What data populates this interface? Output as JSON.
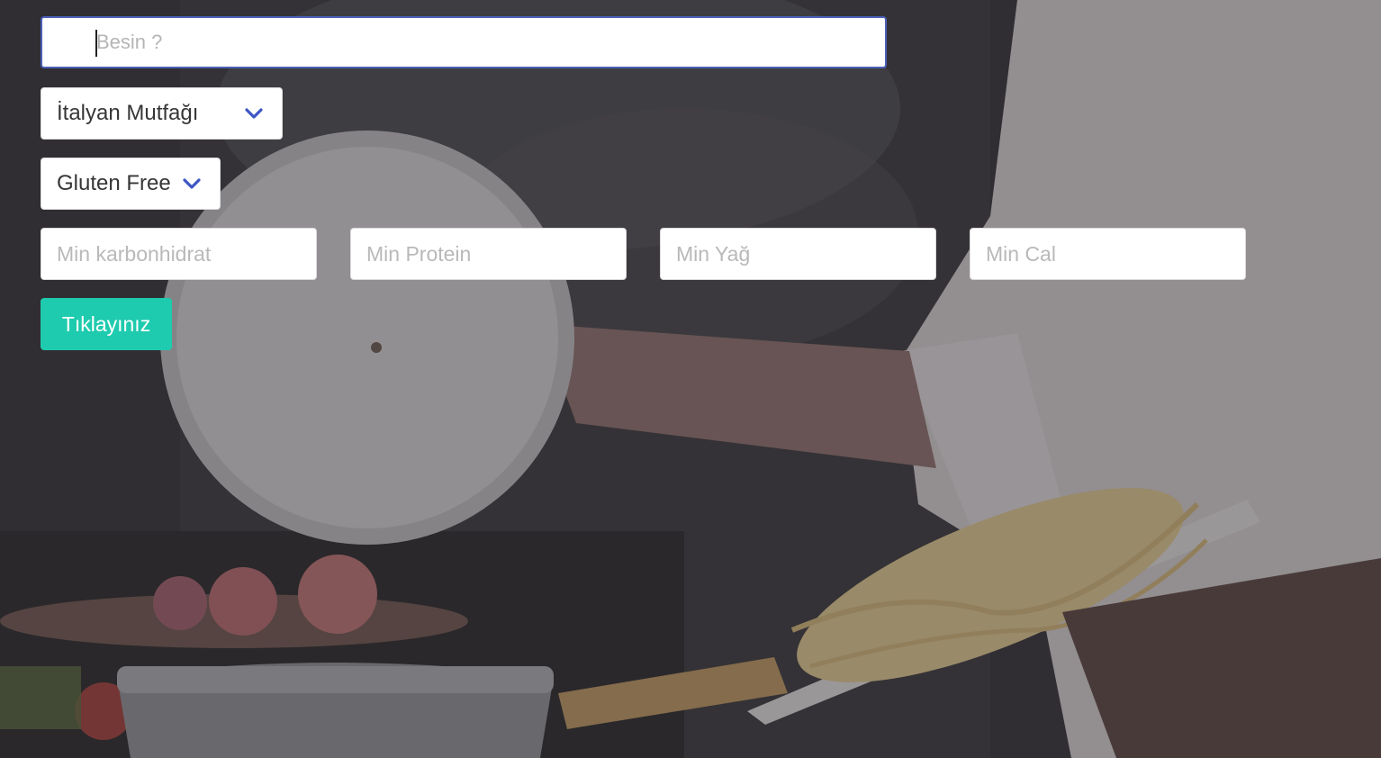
{
  "search": {
    "placeholder": "Besin ?",
    "value": ""
  },
  "filters": {
    "cuisine": {
      "selected": "İtalyan Mutfağı",
      "icon": "chevron-down-icon"
    },
    "diet": {
      "selected": "Gluten Free",
      "icon": "chevron-down-icon"
    }
  },
  "nutrients": {
    "min_carbs_placeholder": "Min karbonhidrat",
    "min_protein_placeholder": "Min Protein",
    "min_fat_placeholder": "Min Yağ",
    "min_cal_placeholder": "Min Cal"
  },
  "submit": {
    "label": "Tıklayınız"
  },
  "colors": {
    "accent_button": "#1ecbae",
    "chevron": "#3e56c4",
    "focus_border": "#4b5fb8"
  }
}
